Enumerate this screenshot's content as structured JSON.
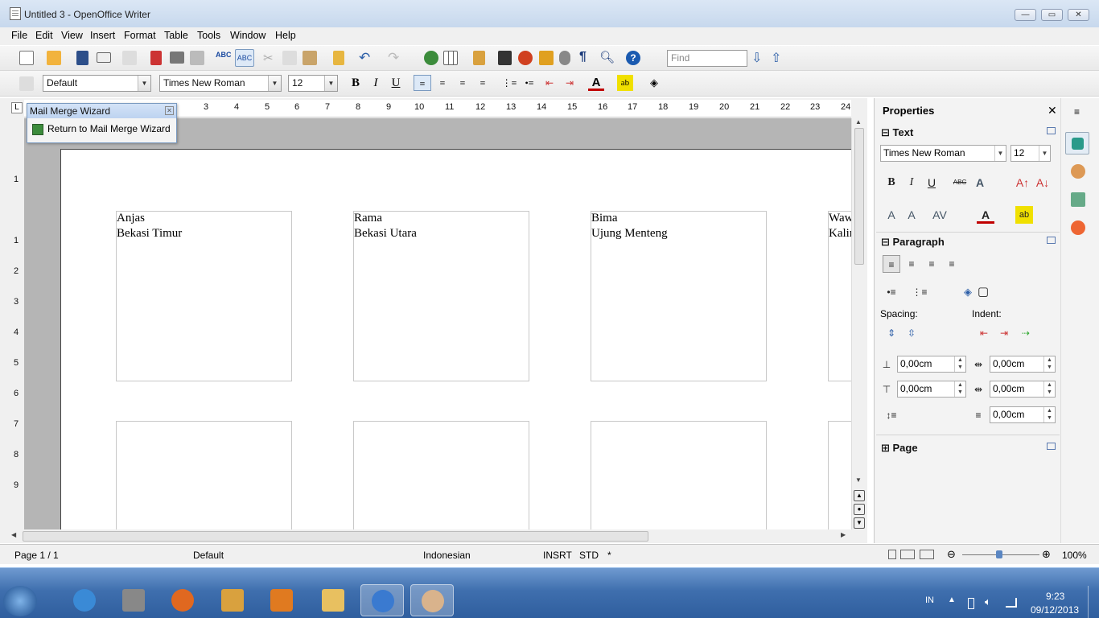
{
  "window": {
    "title": "Untitled 3 - OpenOffice Writer"
  },
  "menu": [
    "File",
    "Edit",
    "View",
    "Insert",
    "Format",
    "Table",
    "Tools",
    "Window",
    "Help"
  ],
  "toolbar": {
    "find_placeholder": "Find"
  },
  "formatting": {
    "paragraph_style": "Default",
    "font_name": "Times New Roman",
    "font_size": "12"
  },
  "ruler": {
    "h_ticks": [
      "3",
      "4",
      "5",
      "6",
      "7",
      "8",
      "9",
      "10",
      "11",
      "12",
      "13",
      "14",
      "15",
      "16",
      "17",
      "18",
      "19",
      "20",
      "21",
      "22",
      "23",
      "24"
    ],
    "v_ticks": [
      "1",
      "1",
      "2",
      "3",
      "4",
      "5",
      "6",
      "7",
      "8",
      "9"
    ]
  },
  "mail_merge": {
    "title": "Mail Merge Wizard",
    "return_label": "Return to Mail Merge Wizard"
  },
  "labels": [
    {
      "name": "Anjas",
      "address": "Bekasi Timur"
    },
    {
      "name": "Rama",
      "address": "Bekasi Utara"
    },
    {
      "name": "Bima",
      "address": "Ujung Menteng"
    },
    {
      "name": "Waw",
      "address": "Kalir"
    }
  ],
  "sidebar": {
    "title": "Properties",
    "text_section": "Text",
    "font_name": "Times New Roman",
    "font_size": "12",
    "paragraph_section": "Paragraph",
    "spacing_label": "Spacing:",
    "indent_label": "Indent:",
    "spacing_above": "0,00cm",
    "spacing_below": "0,00cm",
    "indent_before": "0,00cm",
    "indent_after": "0,00cm",
    "indent_first": "0,00cm",
    "page_section": "Page"
  },
  "status": {
    "page": "Page 1 / 1",
    "style": "Default",
    "language": "Indonesian",
    "insert_mode": "INSRT",
    "selection_mode": "STD",
    "modified": "*",
    "zoom": "100%"
  },
  "taskbar": {
    "ime": "IN",
    "time": "9:23",
    "date": "09/12/2013"
  },
  "colors": {
    "accent": "#3f6fae",
    "font_color": "#c00000",
    "highlight": "#f0e000"
  }
}
